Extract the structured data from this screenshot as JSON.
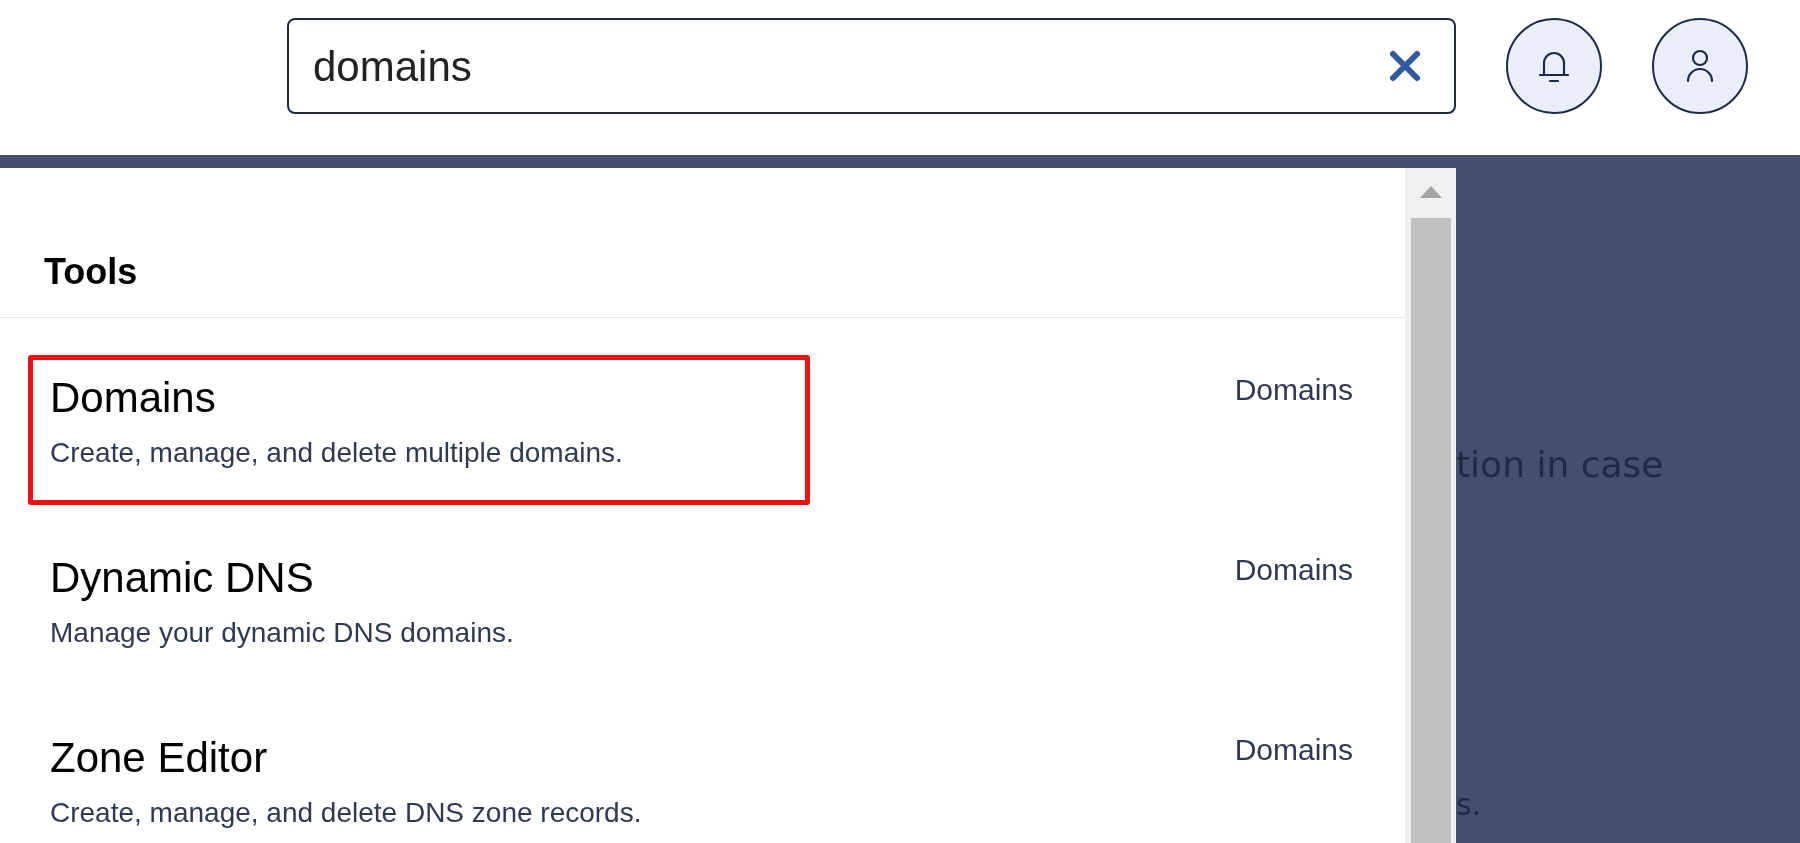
{
  "search": {
    "value": "domains"
  },
  "results": {
    "section_title": "Tools",
    "items": [
      {
        "title": "Domains",
        "description": "Create, manage, and delete multiple domains.",
        "category": "Domains",
        "highlighted": true
      },
      {
        "title": "Dynamic DNS",
        "description": "Manage your dynamic DNS domains.",
        "category": "Domains",
        "highlighted": false
      },
      {
        "title": "Zone Editor",
        "description": "Create, manage, and delete DNS zone records.",
        "category": "Domains",
        "highlighted": false
      }
    ]
  },
  "background_text": [
    "tion in case",
    "s."
  ]
}
